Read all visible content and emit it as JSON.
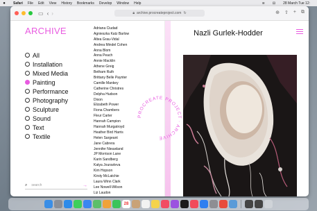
{
  "menubar": {
    "app": "Safari",
    "items": [
      "File",
      "Edit",
      "View",
      "History",
      "Bookmarks",
      "Develop",
      "Window",
      "Help"
    ],
    "datetime": "28 March Tue 12:"
  },
  "browser": {
    "url": "archive.procreateproject.com"
  },
  "site": {
    "logo": "ARCHIVE",
    "selected_category": "Painting",
    "categories": [
      "All",
      "Installation",
      "Mixed Media",
      "Painting",
      "Performance",
      "Photography",
      "Sculpture",
      "Sound",
      "Text",
      "Textile"
    ],
    "search_placeholder": "search",
    "circular_text": "PROCREATE PROJECT · ARCHIVE",
    "artists": [
      "Adriana Ciudad",
      "Agnieszka Katz Barlow",
      "Altea Grau-Vidal",
      "Andrea Mindel Cohen",
      "Anna Blom",
      "Anna Peach",
      "Annie Macklin",
      "Athene Greig",
      "Betham Ruth",
      "Brittany Belle Paynter",
      "Camille Mankey",
      "Catherine Christres",
      "Delpha Hudson",
      "Dixon",
      "Elizabeth Power",
      "Fiona Chambers",
      "Fleur Carter",
      "Hannah Campion",
      "Hannah Murgatroyd",
      "Heather Bird Harris",
      "Helen Sargeant",
      "Jane Cabrera",
      "Jennifer Nieuwland",
      "JP Morrison Lane",
      "Karin Sandberg",
      "Katya Jouravleva",
      "Kim Hopson",
      "Kirsty McLatchie",
      "Laura Winn Clark",
      "Lee Nowell-Wilson",
      "Liz Laudon"
    ],
    "artist_name": "Nazli Gurlek-Hodder"
  },
  "colors": {
    "accent": "#e85be0"
  },
  "dock": {
    "calendar_day": "28",
    "apps": [
      "finder",
      "launchpad",
      "safari",
      "messages",
      "mail",
      "maps",
      "photos",
      "facetime",
      "calendar",
      "contacts",
      "reminders",
      "notes",
      "music",
      "podcasts",
      "tv",
      "news",
      "app-store",
      "settings",
      "chrome",
      "preview",
      "other",
      "other",
      "trash"
    ]
  }
}
